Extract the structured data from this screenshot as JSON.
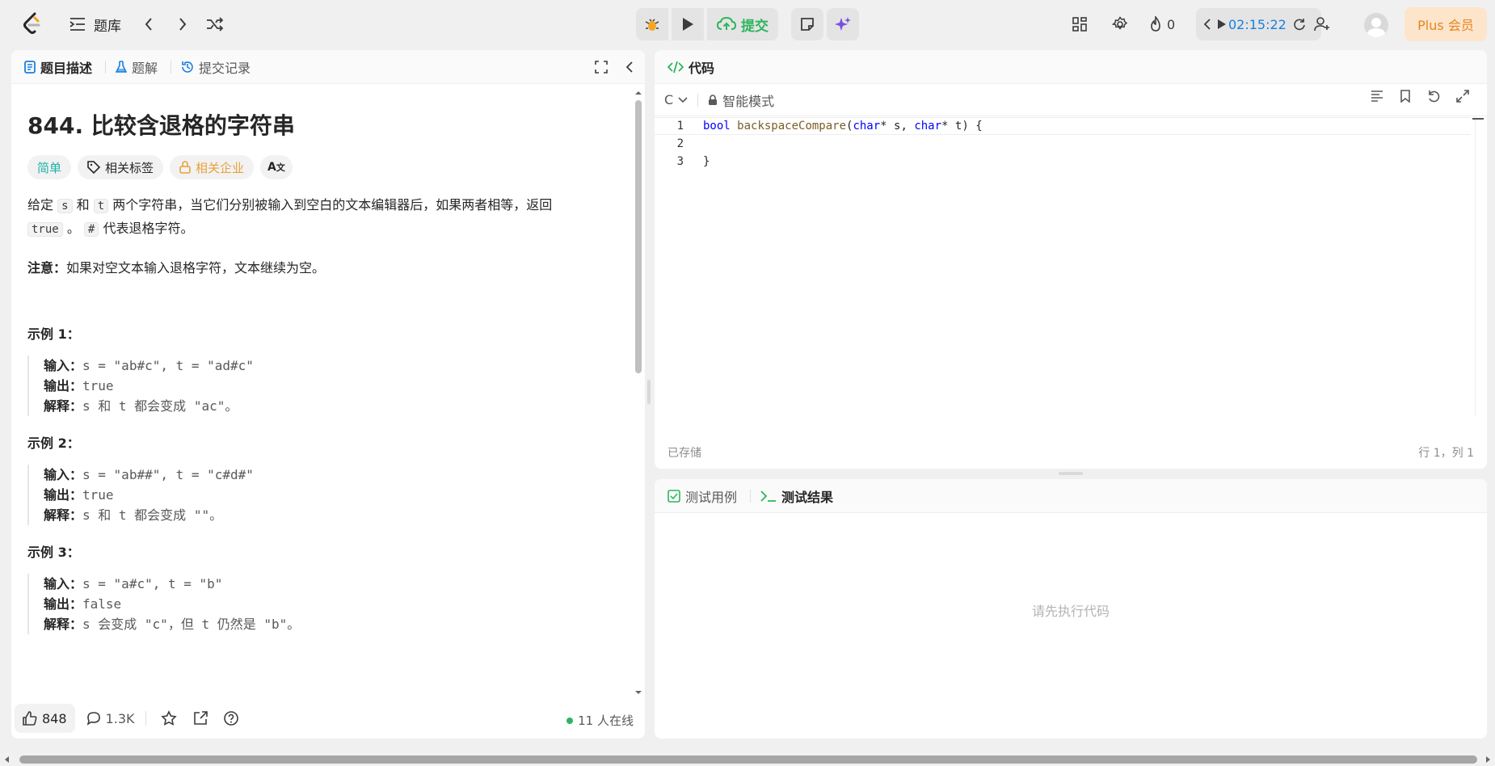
{
  "topbar": {
    "problems_label": "题库",
    "submit_label": "提交",
    "streak_count": "0",
    "timer": "02:15:22",
    "plus_label": "Plus 会员"
  },
  "left": {
    "tabs": [
      "题目描述",
      "题解",
      "提交记录"
    ],
    "title": "844. 比较含退格的字符串",
    "tags": {
      "difficulty": "简单",
      "related_tags": "相关标签",
      "related_companies": "相关企业"
    },
    "desc_parts": [
      "给定",
      "s",
      "和",
      "t",
      "两个字符串，当它们分别被输入到空白的文本编辑器后，如果两者相等，返回",
      "true",
      "。",
      "#",
      "代表退格字符。"
    ],
    "note_label": "注意：",
    "note_text": "如果对空文本输入退格字符，文本继续为空。",
    "examples": [
      {
        "title": "示例 1：",
        "input_label": "输入：",
        "input": "s = \"ab#c\", t = \"ad#c\"",
        "output_label": "输出：",
        "output": "true",
        "explain_label": "解释：",
        "explain": "s 和 t 都会变成 \"ac\"。"
      },
      {
        "title": "示例 2：",
        "input_label": "输入：",
        "input": "s = \"ab##\", t = \"c#d#\"",
        "output_label": "输出：",
        "output": "true",
        "explain_label": "解释：",
        "explain": "s 和 t 都会变成 \"\"。"
      },
      {
        "title": "示例 3：",
        "input_label": "输入：",
        "input": "s = \"a#c\", t = \"b\"",
        "output_label": "输出：",
        "output": "false",
        "explain_label": "解释：",
        "explain": "s 会变成 \"c\"，但 t 仍然是 \"b\"。"
      }
    ],
    "footer": {
      "likes": "848",
      "comments": "1.3K",
      "online": "11 人在线"
    }
  },
  "code": {
    "tab_label": "代码",
    "language": "C",
    "mode_label": "智能模式",
    "lines": [
      {
        "num": "1"
      },
      {
        "num": "2"
      },
      {
        "num": "3"
      }
    ],
    "line1": {
      "kw1": "bool",
      "fn": "backspaceCompare",
      "p1": "(",
      "kw2": "char",
      "p2": "* s, ",
      "kw3": "char",
      "p3": "* t) {"
    },
    "line3": "}",
    "saved_label": "已存储",
    "cursor_pos": "行 1，列 1"
  },
  "result": {
    "tabs": [
      "测试用例",
      "测试结果"
    ],
    "empty_text": "请先执行代码"
  },
  "colors": {
    "accent_green": "#2db55d",
    "timer_blue": "#1a7fe0",
    "easy_teal": "#1db3a6",
    "plus_orange": "#e8851f"
  }
}
